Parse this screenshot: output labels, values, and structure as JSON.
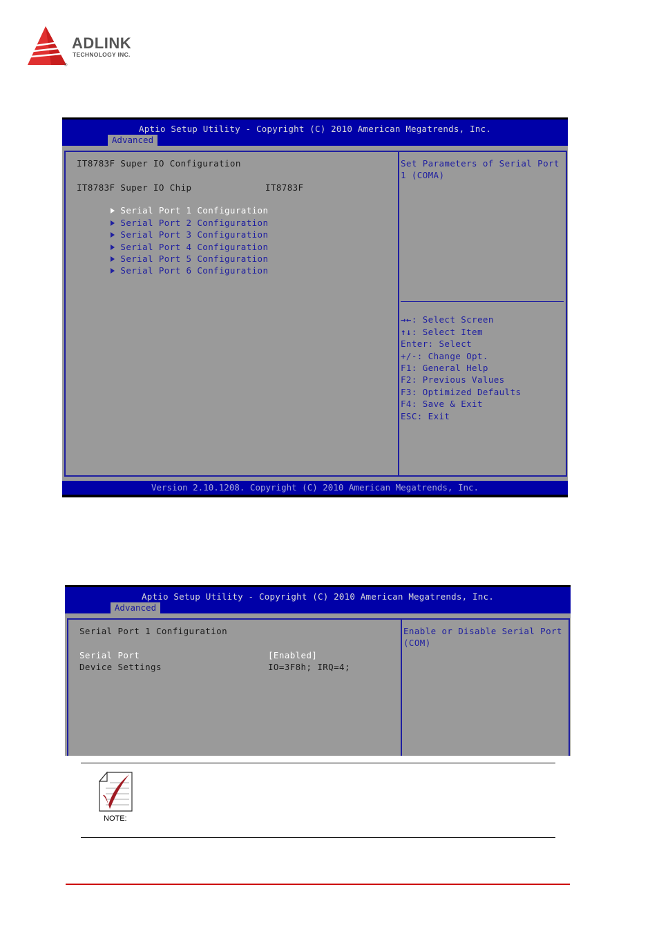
{
  "logo": {
    "brand": "ADLINK",
    "subtitle": "TECHNOLOGY INC.",
    "registered": "®"
  },
  "screens": [
    {
      "header_title": "Aptio Setup Utility - Copyright (C) 2010 American Megatrends, Inc.",
      "active_tab": "Advanced",
      "main": {
        "heading": "IT8783F Super IO Configuration",
        "info_rows": [
          {
            "label": "IT8783F Super IO Chip",
            "value": "IT8783F"
          }
        ],
        "submenus": [
          {
            "label": "Serial Port 1 Configuration",
            "selected": true
          },
          {
            "label": "Serial Port 2 Configuration",
            "selected": false
          },
          {
            "label": "Serial Port 3 Configuration",
            "selected": false
          },
          {
            "label": "Serial Port 4 Configuration",
            "selected": false
          },
          {
            "label": "Serial Port 5 Configuration",
            "selected": false
          },
          {
            "label": "Serial Port 6 Configuration",
            "selected": false
          }
        ]
      },
      "help": {
        "description": [
          "Set Parameters of Serial Port",
          "1 (COMA)"
        ],
        "keys": [
          {
            "key": "→←",
            "action": "Select Screen"
          },
          {
            "key": "↑↓",
            "action": "Select Item"
          },
          {
            "key": "Enter",
            "action": "Select"
          },
          {
            "key": "+/-",
            "action": "Change Opt."
          },
          {
            "key": "F1",
            "action": "General Help"
          },
          {
            "key": "F2",
            "action": "Previous Values"
          },
          {
            "key": "F3",
            "action": "Optimized Defaults"
          },
          {
            "key": "F4",
            "action": "Save & Exit"
          },
          {
            "key": "ESC",
            "action": "Exit"
          }
        ]
      },
      "footer": "Version 2.10.1208. Copyright (C) 2010 American Megatrends, Inc."
    },
    {
      "header_title": "Aptio Setup Utility - Copyright (C) 2010 American Megatrends, Inc.",
      "active_tab": "Advanced",
      "main": {
        "heading": "Serial Port 1 Configuration",
        "settings": [
          {
            "label": "Serial Port",
            "value": "[Enabled]",
            "selected": true
          },
          {
            "label": "Device Settings",
            "value": "IO=3F8h; IRQ=4;",
            "selected": false
          }
        ]
      },
      "help": {
        "description": [
          "Enable or Disable Serial Port",
          "(COM)"
        ]
      }
    }
  ],
  "note": {
    "label": "NOTE:",
    "icon": "checklist-note-icon"
  },
  "colors": {
    "bios_blue": "#0000a8",
    "bios_gray": "#9a9a9a",
    "text_blue": "#1e1ea0",
    "brand_red": "#cc0000"
  }
}
